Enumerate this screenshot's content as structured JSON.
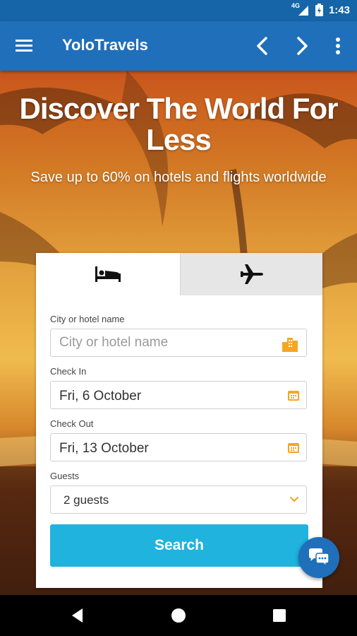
{
  "status_bar": {
    "network": "4G",
    "time": "1:43"
  },
  "app_bar": {
    "title": "YoloTravels",
    "icons": [
      "menu-icon",
      "chevron-left-icon",
      "chevron-right-icon",
      "more-vert-icon"
    ]
  },
  "hero": {
    "headline": "Discover The World For Less",
    "subtitle": "Save up to 60% on hotels and flights worldwide"
  },
  "tabs": [
    {
      "icon": "bed-icon",
      "active": true
    },
    {
      "icon": "airplane-icon",
      "active": false
    }
  ],
  "form": {
    "city": {
      "label": "City or hotel name",
      "placeholder": "City or hotel name",
      "value": ""
    },
    "check_in": {
      "label": "Check In",
      "value": "Fri, 6 October"
    },
    "check_out": {
      "label": "Check Out",
      "value": "Fri, 13 October"
    },
    "guests": {
      "label": "Guests",
      "value": "2 guests"
    },
    "search_label": "Search"
  },
  "colors": {
    "app_bar": "#1f6fba",
    "status_bar": "#1565a8",
    "accent_orange": "#f5a623",
    "search_button": "#1fb3de"
  }
}
